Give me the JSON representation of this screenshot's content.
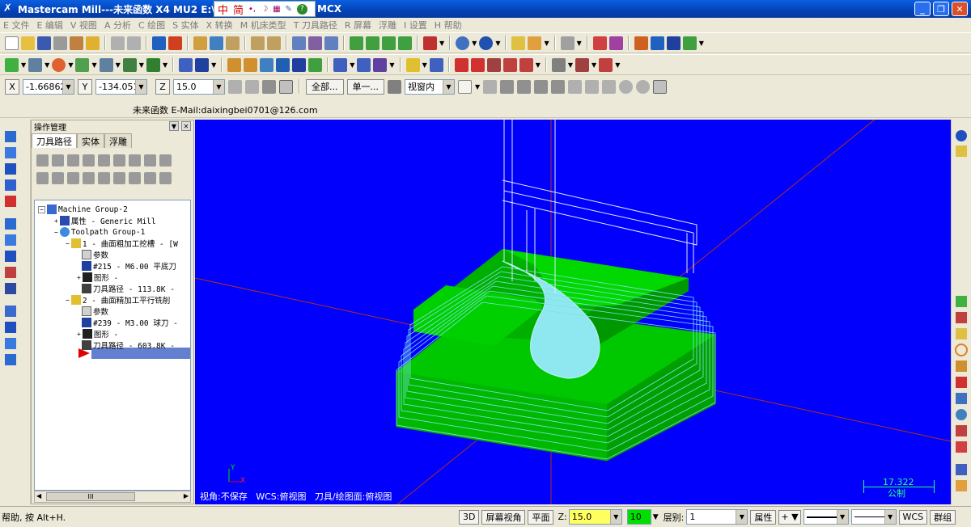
{
  "app": {
    "title": "Mastercam Mill---未来函数 X4 MU2  E:\\51-MA",
    "title_suffix": "MCX"
  },
  "ime": {
    "mode1": "中",
    "mode2": "简"
  },
  "menu": [
    "E 文件",
    "E 编辑",
    "V 视图",
    "A 分析",
    "C 绘图",
    "S 实体",
    "X 转换",
    "M 机床类型",
    "T 刀具路径",
    "R 屏幕",
    "浮雕",
    "I 设置",
    "H 帮助"
  ],
  "coords": {
    "x_label": "X",
    "x_value": "-1.66862",
    "y_label": "Y",
    "y_value": "-134.0519",
    "z_label": "Z",
    "z_value": "15.0",
    "all_button": "全部...",
    "single_button": "单一...",
    "view_window": "视窗内"
  },
  "info": {
    "text": "未来函数 E-Mail:daixingbei0701@126.com"
  },
  "op_manager": {
    "title": "操作管理",
    "tabs": [
      "刀具路径",
      "实体",
      "浮雕"
    ],
    "tree": [
      {
        "text": "Machine Group-2",
        "indent": 0
      },
      {
        "text": "属性 - Generic Mill",
        "indent": 1
      },
      {
        "text": "Toolpath Group-1",
        "indent": 1
      },
      {
        "text": "1 - 曲面粗加工挖槽 - [W",
        "indent": 2
      },
      {
        "text": "参数",
        "indent": 3
      },
      {
        "text": "#215 - M6.00 平底刀",
        "indent": 3
      },
      {
        "text": "图形 -",
        "indent": 3
      },
      {
        "text": "刀具路径 - 113.8K -",
        "indent": 3
      },
      {
        "text": "2 - 曲面精加工平行铣削",
        "indent": 2
      },
      {
        "text": "参数",
        "indent": 3
      },
      {
        "text": "#239 - M3.00 球刀 -",
        "indent": 3
      },
      {
        "text": "图形 -",
        "indent": 3
      },
      {
        "text": "刀具路径 - 603.8K -",
        "indent": 3
      }
    ],
    "scroll_label": "III"
  },
  "viewport": {
    "status_text": "视角:不保存   WCS:俯视图   刀具/绘图面:俯视图",
    "scale_value": "17.322",
    "scale_unit": "公制",
    "axis_x": "X",
    "axis_y": "Y"
  },
  "status": {
    "help": "帮助, 按 Alt+H.",
    "btn_3d": "3D",
    "btn_screen_view": "屏幕视角",
    "btn_plane": "平面",
    "z_label": "Z:",
    "z_value": "15.0",
    "color_value": "10",
    "level_label": "层别:",
    "level_value": "1",
    "attr_button": "属性",
    "wcs_button": "WCS",
    "group_button": "群组"
  },
  "colors": {
    "viewport_bg": "#0000fc",
    "stock_green": "#00d800",
    "toolpath": "#8fe8f0"
  }
}
